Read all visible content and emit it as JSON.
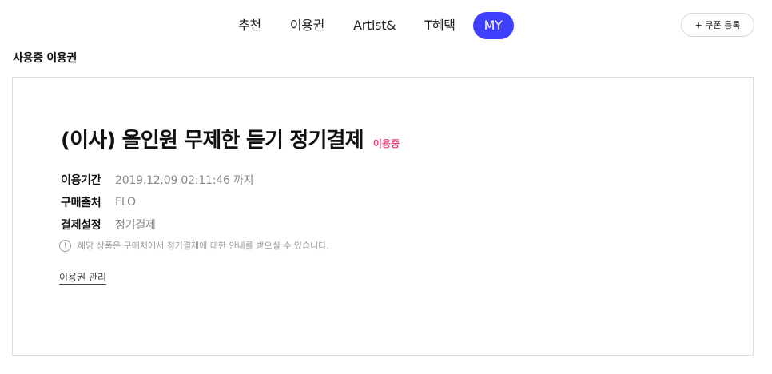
{
  "nav": {
    "tabs": [
      {
        "label": "추천"
      },
      {
        "label": "이용권"
      },
      {
        "label": "Artist&"
      },
      {
        "label": "T혜택"
      },
      {
        "label": "MY",
        "active": true
      }
    ],
    "coupon_button": "+ 쿠폰 등록"
  },
  "section": {
    "title": "사용중 이용권"
  },
  "pass": {
    "title": "(이사) 올인원 무제한 듣기 정기결제",
    "status": "이용중",
    "status_color": "#e8467c",
    "details": [
      {
        "label": "이용기간",
        "value": "2019.12.09 02:11:46 까지"
      },
      {
        "label": "구매출처",
        "value": "FLO"
      },
      {
        "label": "결제설정",
        "value": "정기결제"
      }
    ],
    "notice_icon": "exclamation-circle-icon",
    "notice": "해당 상품은 구매처에서 정기결제에 대한 안내를 받으실 수 있습니다.",
    "manage_link": "이용권 관리"
  },
  "colors": {
    "accent": "#3f3fff"
  }
}
